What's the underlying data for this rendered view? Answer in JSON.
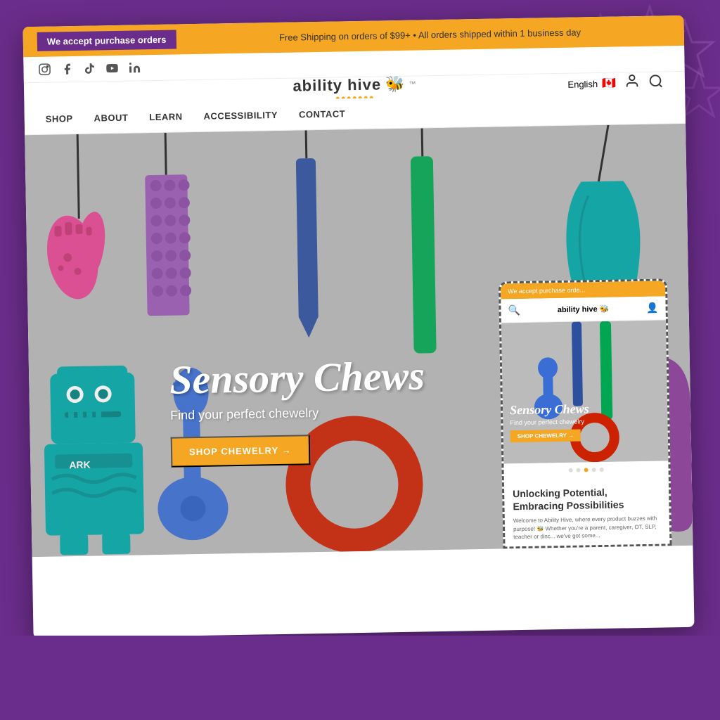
{
  "page": {
    "background_color": "#6B2D8B"
  },
  "announcement_bar": {
    "left_text": "We accept purchase orders",
    "center_text": "Free Shipping on orders of $99+ • All orders shipped within 1 business day"
  },
  "social": {
    "icons": [
      "instagram",
      "facebook",
      "tiktok",
      "youtube",
      "linkedin"
    ]
  },
  "logo": {
    "text": "ability hive",
    "bee_icon": "🐝",
    "tm": "™"
  },
  "navigation": {
    "links": [
      "SHOP",
      "ABOUT",
      "LEARN",
      "ACCESSIBILITY",
      "CONTACT"
    ],
    "language": "English",
    "language_flag": "🍁"
  },
  "hero": {
    "title": "Sensory Chews",
    "subtitle": "Find your perfect chewelry",
    "button_label": "SHOP CHEWELRY →"
  },
  "mobile_preview": {
    "announcement": "We accept purchase orde...",
    "logo": "ability hive 🐝",
    "hero_title": "Sensory Chews",
    "hero_subtitle": "Find your perfect chewelry",
    "button_label": "SHOP CHEWELRY →",
    "dots": [
      false,
      false,
      true,
      false,
      false
    ],
    "section_title": "Unlocking Potential, Embracing Possibilities",
    "section_text": "Welcome to Ability Hive, where every product buzzes with purpose! 🐝 Whether you're a parent, caregiver, OT, SLP, teacher or disc... we've got some..."
  }
}
